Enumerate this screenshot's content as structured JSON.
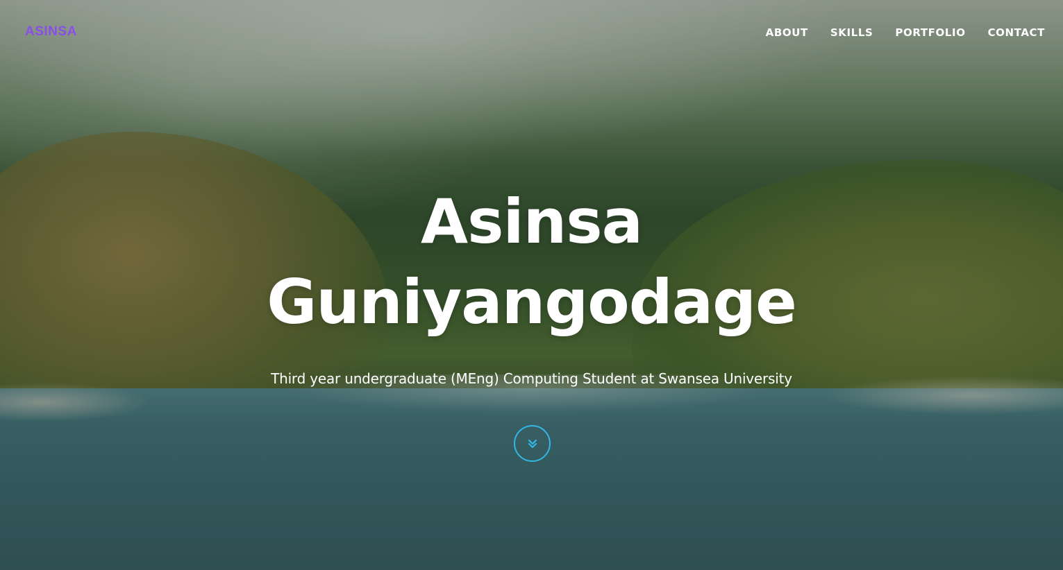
{
  "nav": {
    "brand": "ASINSA",
    "links": [
      "ABOUT",
      "SKILLS",
      "PORTFOLIO",
      "CONTACT"
    ]
  },
  "hero": {
    "title_line1": "Asinsa",
    "title_line2": "Guniyangodage",
    "subtitle": "Third year undergraduate (MEng) Computing Student at Swansea University",
    "scroll_icon": "chevron-double-down-icon"
  },
  "colors": {
    "brand": "#8a4fe6",
    "accent": "#34b7e8",
    "text": "#ffffff"
  }
}
